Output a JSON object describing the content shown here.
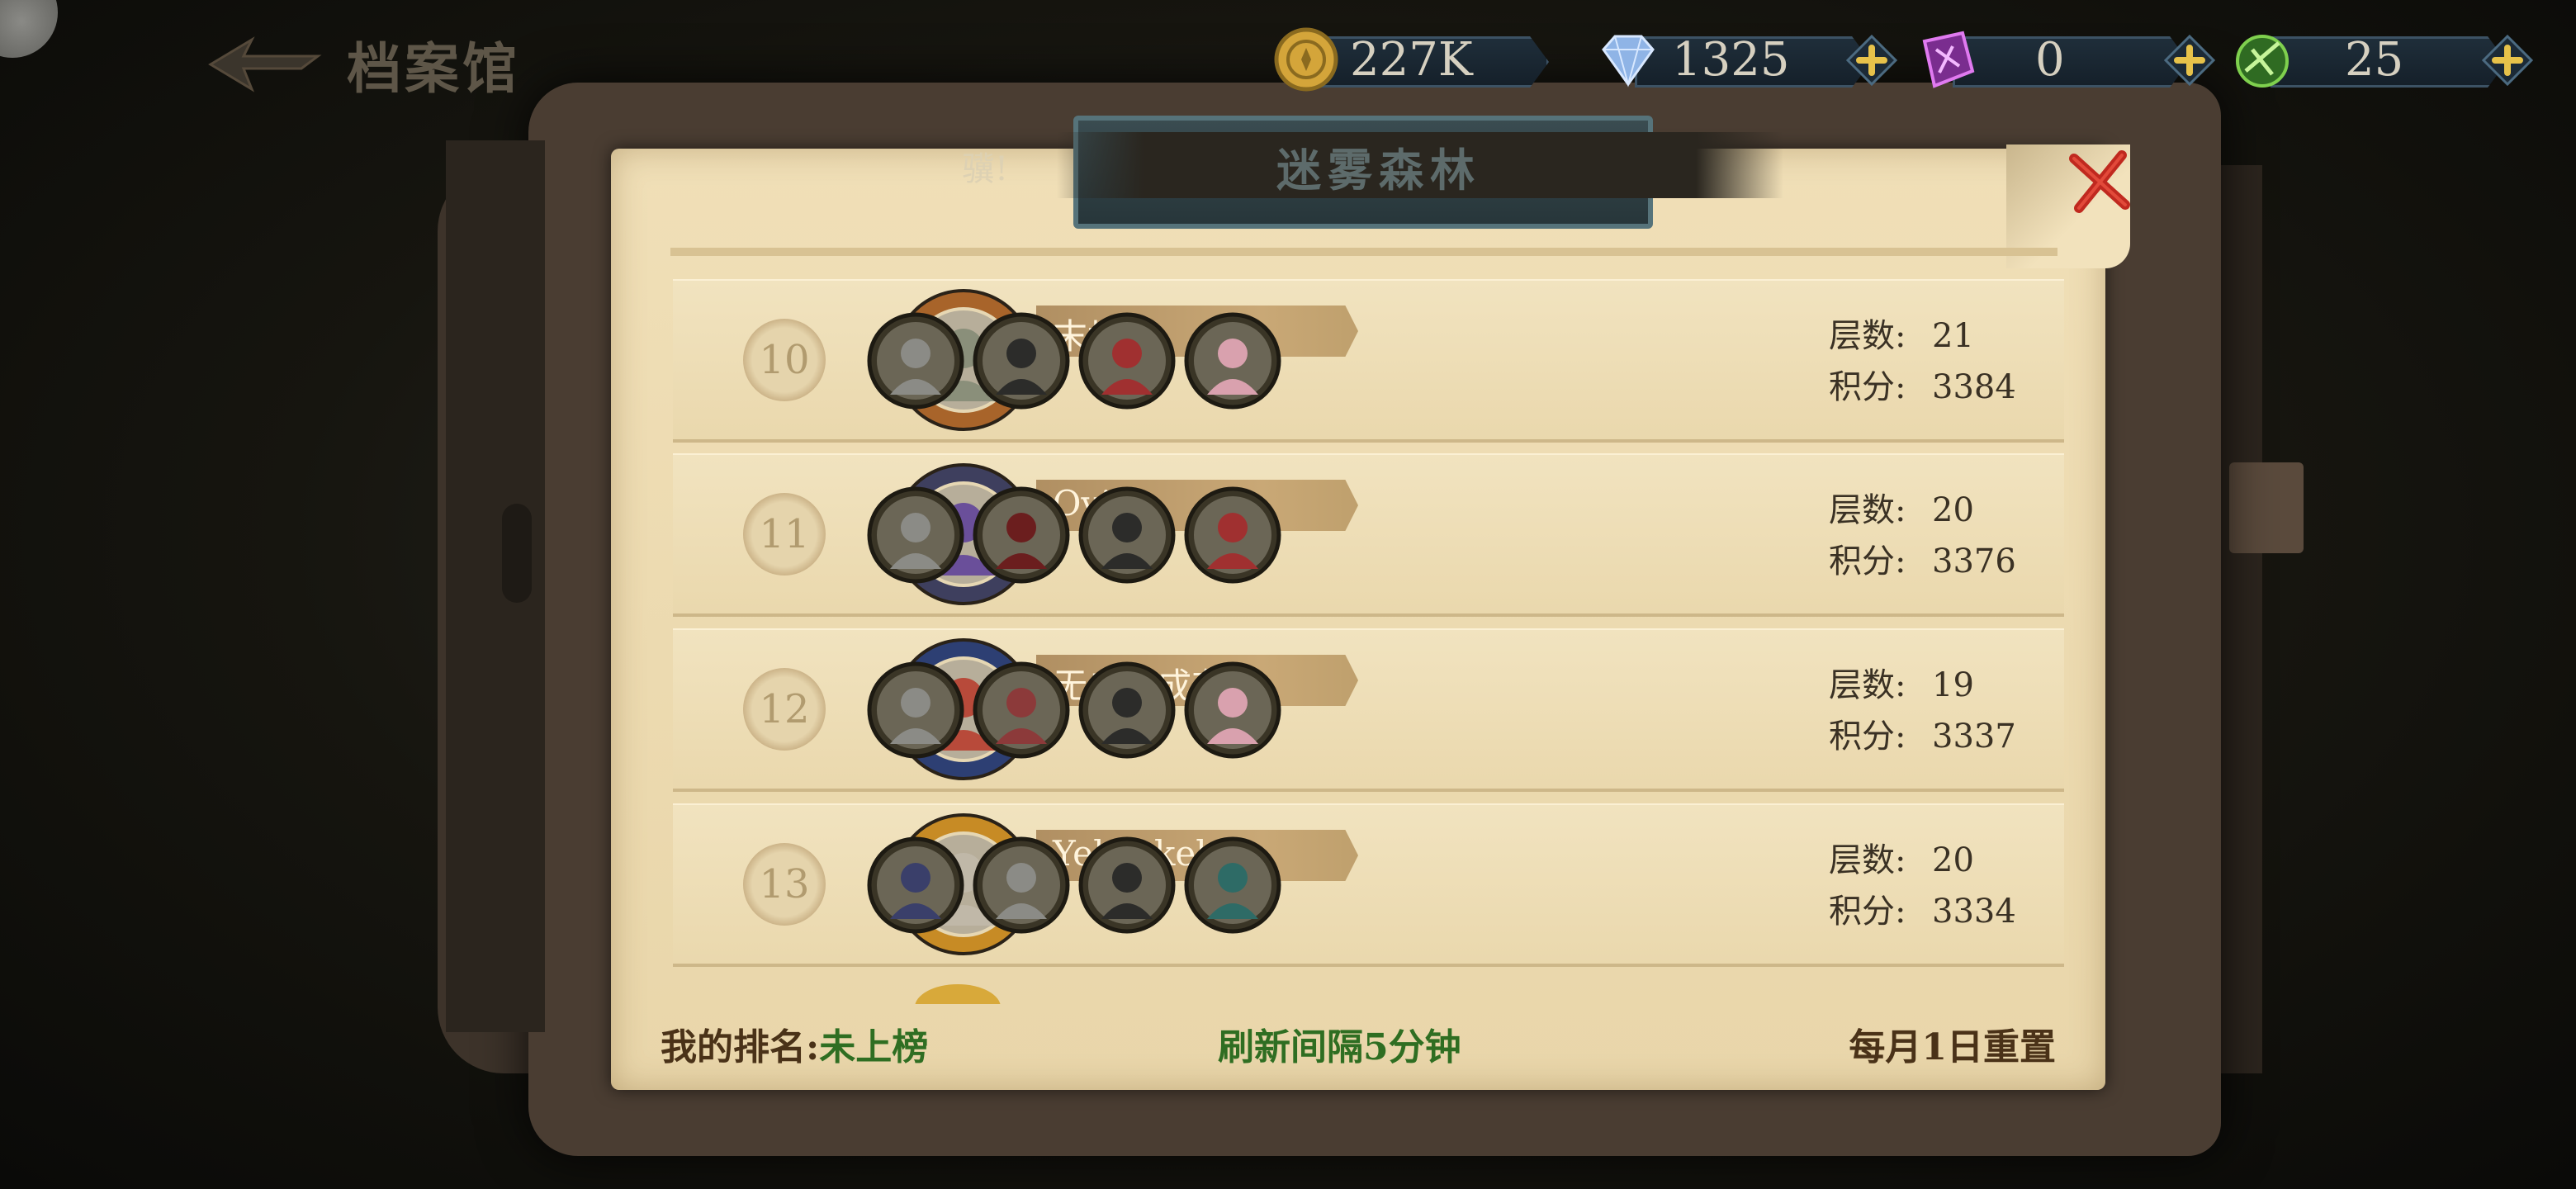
{
  "header": {
    "title": "档案馆",
    "currencies": [
      {
        "name": "coin",
        "icon": "gold-coin-icon",
        "value": "227K",
        "has_plus": false,
        "color": "#d4a53a"
      },
      {
        "name": "diamond",
        "icon": "diamond-icon",
        "value": "1325",
        "has_plus": true,
        "color": "#8fb4e6"
      },
      {
        "name": "purple-shard",
        "icon": "purple-crystal-icon",
        "value": "0",
        "has_plus": true,
        "color": "#b44bd0"
      },
      {
        "name": "green-token",
        "icon": "green-token-icon",
        "value": "25",
        "has_plus": true,
        "color": "#5fbf3a"
      }
    ]
  },
  "panel": {
    "title": "迷雾森林",
    "marquee": "骥!",
    "rows": [
      {
        "rank": "10",
        "name": "末世者",
        "floors_label": "层数:",
        "floors": "21",
        "score_label": "积分:",
        "score": "3384",
        "frame_color": "#a8642a",
        "avatar_color": "#8a8f7a",
        "team": [
          "#8b8b86",
          "#2c2c2a",
          "#a03030",
          "#d9a1ae"
        ]
      },
      {
        "rank": "11",
        "name": "Ovie",
        "floors_label": "层数:",
        "floors": "20",
        "score_label": "积分:",
        "score": "3376",
        "frame_color": "#3e3f5e",
        "avatar_color": "#6a4f9a",
        "team": [
          "#8b8b86",
          "#6b1e1e",
          "#2c2c2a",
          "#a03030"
        ]
      },
      {
        "rank": "12",
        "name": "无自天成有",
        "floors_label": "层数:",
        "floors": "19",
        "score_label": "积分:",
        "score": "3337",
        "frame_color": "#2d3f73",
        "avatar_color": "#b84a3a",
        "team": [
          "#8b8b86",
          "#8c3a3a",
          "#2c2c2a",
          "#d9a1ae"
        ]
      },
      {
        "rank": "13",
        "name": "Yehezkel",
        "floors_label": "层数:",
        "floors": "20",
        "score_label": "积分:",
        "score": "3334",
        "frame_color": "#c78b25",
        "avatar_color": "#c0b8a8",
        "team": [
          "#3a3f6a",
          "#8b8b86",
          "#2c2c2a",
          "#2e6b66"
        ]
      }
    ]
  },
  "footer": {
    "my_rank_label": "我的排名:",
    "my_rank_value": "未上榜",
    "refresh": "刷新间隔5分钟",
    "reset": "每月1日重置"
  },
  "colors": {
    "paper": "#efdfb6",
    "ribbon": "#c5a372",
    "accent_green": "#2f6e22",
    "close_red": "#c0291f"
  }
}
